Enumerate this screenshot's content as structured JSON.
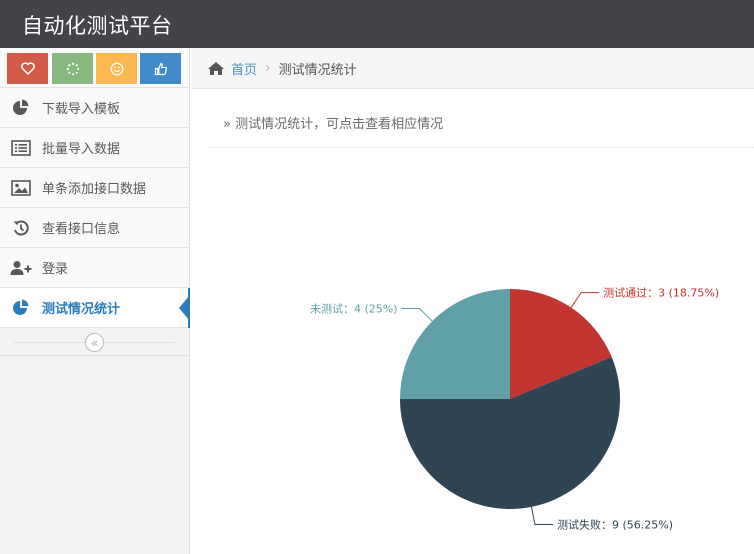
{
  "app": {
    "title": "自动化测试平台"
  },
  "shortcuts": [
    {
      "icon": "heart-icon",
      "color": "#d15b47"
    },
    {
      "icon": "spinner-icon",
      "color": "#87b87f"
    },
    {
      "icon": "smile-icon",
      "color": "#ffb752"
    },
    {
      "icon": "thumbs-up-icon",
      "color": "#428bca"
    }
  ],
  "sidebar": {
    "items": [
      {
        "label": "下载导入模板",
        "icon": "pie-chart-icon"
      },
      {
        "label": "批量导入数据",
        "icon": "list-icon"
      },
      {
        "label": "单条添加接口数据",
        "icon": "picture-icon"
      },
      {
        "label": "查看接口信息",
        "icon": "history-icon"
      },
      {
        "label": "登录",
        "icon": "user-add-icon"
      },
      {
        "label": "测试情况统计",
        "icon": "pie-chart-icon",
        "active": true
      }
    ],
    "collapse_icon": "double-angle-left-icon"
  },
  "breadcrumb": {
    "home": "首页",
    "current": "测试情况统计"
  },
  "page_header": {
    "text": "» 测试情况统计，可点击查看相应情况"
  },
  "chart_data": {
    "type": "pie",
    "slices": [
      {
        "label": "测试通过",
        "value": 3,
        "percent": "18.75%",
        "color": "#c23531",
        "display": "测试通过：3 (18.75%)"
      },
      {
        "label": "测试失败",
        "value": 9,
        "percent": "56.25%",
        "color": "#2f4554",
        "display": "测试失败：9 (56.25%)"
      },
      {
        "label": "未测试",
        "value": 4,
        "percent": "25%",
        "color": "#61a0a8",
        "display": "未测试：4 (25%)"
      }
    ]
  }
}
